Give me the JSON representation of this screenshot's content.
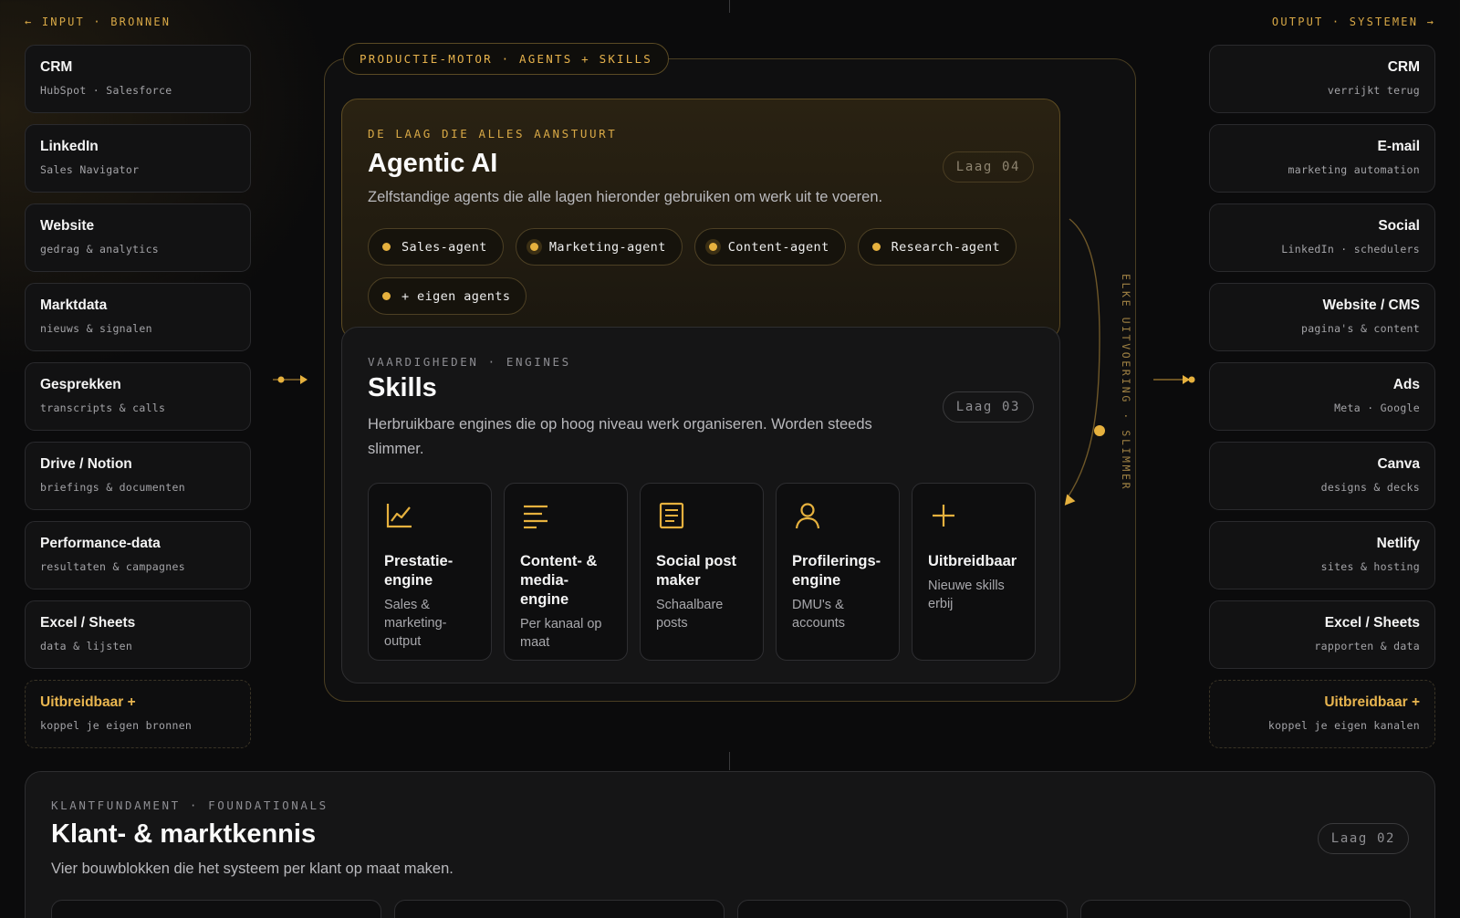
{
  "inputs": {
    "title": "← INPUT · BRONNEN",
    "items": [
      {
        "name": "CRM",
        "sub": "HubSpot · Salesforce"
      },
      {
        "name": "LinkedIn",
        "sub": "Sales Navigator"
      },
      {
        "name": "Website",
        "sub": "gedrag & analytics"
      },
      {
        "name": "Marktdata",
        "sub": "nieuws & signalen"
      },
      {
        "name": "Gesprekken",
        "sub": "transcripts & calls"
      },
      {
        "name": "Drive / Notion",
        "sub": "briefings & documenten"
      },
      {
        "name": "Performance-data",
        "sub": "resultaten & campagnes"
      },
      {
        "name": "Excel / Sheets",
        "sub": "data & lijsten"
      },
      {
        "name": "Uitbreidbaar +",
        "sub": "koppel je eigen bronnen"
      }
    ]
  },
  "outputs": {
    "title": "OUTPUT · SYSTEMEN →",
    "items": [
      {
        "name": "CRM",
        "sub": "verrijkt terug"
      },
      {
        "name": "E-mail",
        "sub": "marketing automation"
      },
      {
        "name": "Social",
        "sub": "LinkedIn · schedulers"
      },
      {
        "name": "Website / CMS",
        "sub": "pagina's & content"
      },
      {
        "name": "Ads",
        "sub": "Meta · Google"
      },
      {
        "name": "Canva",
        "sub": "designs & decks"
      },
      {
        "name": "Netlify",
        "sub": "sites & hosting"
      },
      {
        "name": "Excel / Sheets",
        "sub": "rapporten & data"
      },
      {
        "name": "Uitbreidbaar +",
        "sub": "koppel je eigen kanalen"
      }
    ]
  },
  "engine": {
    "pill": "PRODUCTIE-MOTOR · AGENTS + SKILLS",
    "loop_label": "ELKE UITVOERING · SLIMMER",
    "ai": {
      "eyebrow": "DE LAAG DIE ALLES AANSTUURT",
      "title": "Agentic AI",
      "laag": "Laag 04",
      "desc": "Zelfstandige agents die alle lagen hieronder gebruiken om werk uit te voeren.",
      "agents": [
        "Sales-agent",
        "Marketing-agent",
        "Content-agent",
        "Research-agent",
        "+ eigen agents"
      ]
    },
    "skills": {
      "eyebrow": "VAARDIGHEDEN · ENGINES",
      "title": "Skills",
      "laag": "Laag 03",
      "desc": "Herbruikbare engines die op hoog niveau werk organiseren. Worden steeds slimmer.",
      "items": [
        {
          "icon": "chart-line-icon",
          "name": "Prestatie-engine",
          "sub": "Sales & marketing-output"
        },
        {
          "icon": "text-lines-icon",
          "name": "Content- & media-engine",
          "sub": "Per kanaal op maat"
        },
        {
          "icon": "document-icon",
          "name": "Social post maker",
          "sub": "Schaalbare posts"
        },
        {
          "icon": "person-icon",
          "name": "Profilerings-engine",
          "sub": "DMU's & accounts"
        },
        {
          "icon": "plus-icon",
          "name": "Uitbreidbaar",
          "sub": "Nieuwe skills erbij"
        }
      ]
    }
  },
  "foundation": {
    "eyebrow": "KLANTFUNDAMENT · FOUNDATIONALS",
    "title": "Klant- & marktkennis",
    "laag": "Laag 02",
    "desc": "Vier bouwblokken die het systeem per klant op maat maken."
  },
  "colors": {
    "accent": "#e6b13e",
    "background": "#0b0b0c",
    "card": "#121213"
  }
}
